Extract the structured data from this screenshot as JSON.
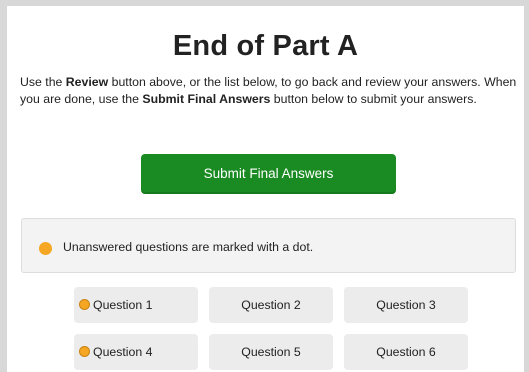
{
  "page": {
    "title": "End of Part A",
    "intro": {
      "t1": "Use the ",
      "b1": "Review",
      "t2": " button above, or the list below, to go back and review your answers. When you are done, use the ",
      "b2": "Submit Final Answers",
      "t3": " button below to submit your answers."
    },
    "submit_label": "Submit Final Answers",
    "notice": "Unanswered questions are marked with a dot."
  },
  "questions": [
    {
      "label": "Question 1",
      "unanswered": true
    },
    {
      "label": "Question 2",
      "unanswered": false
    },
    {
      "label": "Question 3",
      "unanswered": false
    },
    {
      "label": "Question 4",
      "unanswered": true
    },
    {
      "label": "Question 5",
      "unanswered": false
    },
    {
      "label": "Question 6",
      "unanswered": false
    }
  ],
  "colors": {
    "submit": "#1a8a22",
    "unanswered_dot": "#f5a623",
    "question_bg": "#ececec",
    "notice_bg": "#f3f3f3"
  }
}
